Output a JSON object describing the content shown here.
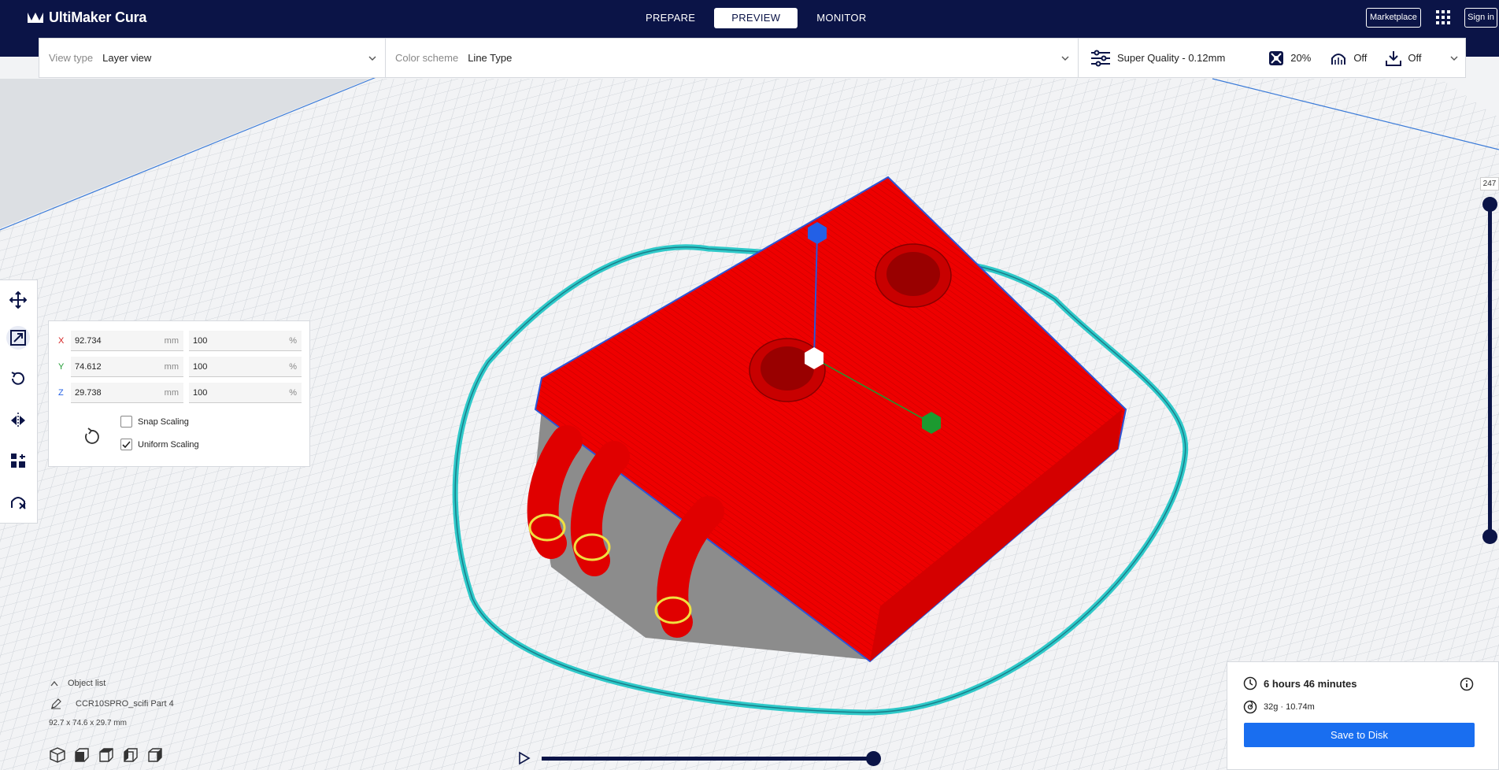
{
  "app": {
    "title": "UltiMaker Cura"
  },
  "stages": [
    {
      "label": "PREPARE"
    },
    {
      "label": "PREVIEW"
    },
    {
      "label": "MONITOR"
    }
  ],
  "header": {
    "marketplace_label": "Marketplace",
    "signin_label": "Sign in"
  },
  "viewbar": {
    "view_type_label": "View type",
    "view_type_value": "Layer view",
    "color_scheme_label": "Color scheme",
    "color_scheme_value": "Line Type",
    "profile": "Super Quality - 0.12mm",
    "infill": "20%",
    "support": "Off",
    "adhesion": "Off"
  },
  "tools": [
    "move-tool",
    "scale-tool",
    "rotate-tool",
    "mirror-tool",
    "per-model-settings-tool",
    "support-blocker-tool"
  ],
  "scale": {
    "x_label": "X",
    "x_value": "92.734",
    "x_unit": "mm",
    "x_pct": "100",
    "pct_unit": "%",
    "y_label": "Y",
    "y_value": "74.612",
    "y_unit": "mm",
    "y_pct": "100",
    "z_label": "Z",
    "z_value": "29.738",
    "z_unit": "mm",
    "z_pct": "100",
    "snap_label": "Snap Scaling",
    "snap_checked": false,
    "uniform_label": "Uniform Scaling",
    "uniform_checked": true
  },
  "objects": {
    "toggle_label": "Object list",
    "name": "CCR10SPRO_scifi Part 4",
    "dimensions": "92.7 x 74.6 x 29.7 mm"
  },
  "layer": {
    "current": "247"
  },
  "print": {
    "time": "6 hours 46 minutes",
    "material": "32g · 10.74m",
    "save_label": "Save to Disk"
  },
  "colors": {
    "brand": "#0b1447",
    "accent": "#196ef0",
    "model_red": "#ff0000",
    "skirt_cyan": "#3fd6d6",
    "support_gray": "#8a8a8a"
  }
}
